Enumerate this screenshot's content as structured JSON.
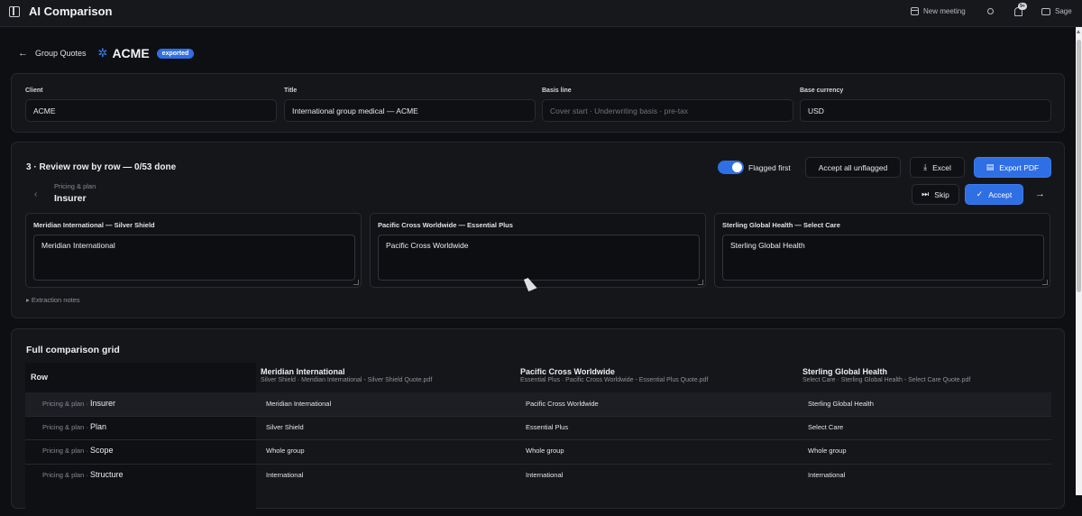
{
  "app": {
    "title": "AI Comparison",
    "topbar": {
      "new_meeting": "New meeting",
      "notifications_badge": "9+",
      "user": "Sage",
      "icons": [
        "sidebar-toggle-icon",
        "calendar-icon",
        "sun-icon",
        "bell-icon",
        "chat-icon"
      ]
    }
  },
  "header": {
    "back_label": "Group Quotes",
    "company": "ACME",
    "status_badge": "exported",
    "accent": "#2f6fe4"
  },
  "meta": {
    "client": {
      "label": "Client",
      "value": "ACME"
    },
    "title": {
      "label": "Title",
      "value": "International group medical — ACME"
    },
    "basis": {
      "label": "Basis line",
      "placeholder": "Cover start · Underwriting basis · pre-tax"
    },
    "currency": {
      "label": "Base currency",
      "value": "USD"
    }
  },
  "review": {
    "title": "3 · Review row by row — 0/53 done",
    "toggle_label": "Flagged first",
    "toggle_on": true,
    "accept_all_label": "Accept all unflagged",
    "excel_label": "Excel",
    "export_pdf_label": "Export PDF",
    "skip_label": "Skip",
    "accept_label": "Accept",
    "current_row_group": "Pricing & plan",
    "current_row_name": "Insurer",
    "quotes": [
      {
        "title": "Meridian International — Silver Shield",
        "value": "Meridian International"
      },
      {
        "title": "Pacific Cross Worldwide — Essential Plus",
        "value": "Pacific Cross Worldwide"
      },
      {
        "title": "Sterling Global Health — Select Care",
        "value": "Sterling Global Health"
      }
    ],
    "extraction_notes": "Extraction notes"
  },
  "grid": {
    "title": "Full comparison grid",
    "row_header": "Row",
    "columns": [
      {
        "name": "Meridian International",
        "sub": "Silver Shield · Meridian International - Silver Shield Quote.pdf"
      },
      {
        "name": "Pacific Cross Worldwide",
        "sub": "Essential Plus · Pacific Cross Worldwide - Essential Plus Quote.pdf"
      },
      {
        "name": "Sterling Global Health",
        "sub": "Select Care · Sterling Global Health - Select Care Quote.pdf"
      }
    ],
    "group_separator": " · ",
    "rows": [
      {
        "group": "Pricing & plan",
        "name": "Insurer",
        "cells": [
          "Meridian International",
          "Pacific Cross Worldwide",
          "Sterling Global Health"
        ]
      },
      {
        "group": "Pricing & plan",
        "name": "Plan",
        "cells": [
          "Silver Shield",
          "Essential Plus",
          "Select Care"
        ]
      },
      {
        "group": "Pricing & plan",
        "name": "Scope",
        "cells": [
          "Whole group",
          "Whole group",
          "Whole group"
        ]
      },
      {
        "group": "Pricing & plan",
        "name": "Structure",
        "cells": [
          "International",
          "International",
          "International"
        ]
      }
    ]
  }
}
